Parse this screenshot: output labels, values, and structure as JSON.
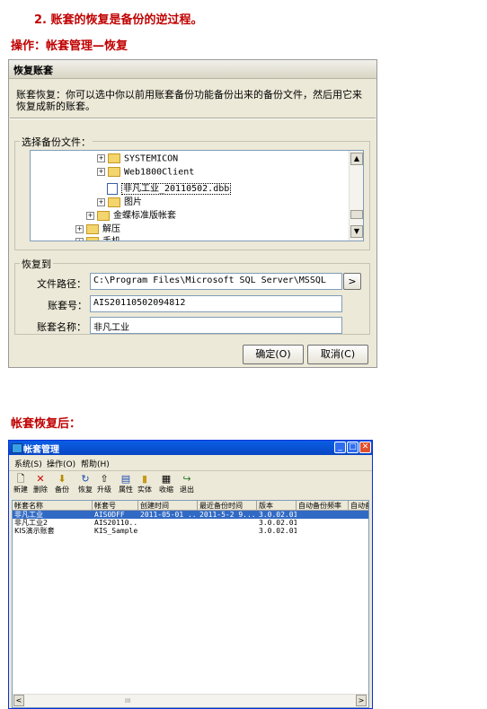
{
  "doc": {
    "step_heading_num": "2.",
    "step_heading_text": "账套的恢复是备份的逆过程。",
    "operation_heading": "操作：帐套管理—恢复",
    "after_heading": "帐套恢复后："
  },
  "restore_dialog": {
    "title": "恢复账套",
    "description": "账套恢复：你可以选中你以前用账套备份功能备份出来的备份文件，然后用它来恢复成新的账套。",
    "file_group_label": "选择备份文件：",
    "tree": [
      {
        "label": "SYSTEMICON",
        "type": "folder",
        "expander": "+"
      },
      {
        "label": "Web1800Client",
        "type": "folder",
        "expander": "+"
      },
      {
        "label": "非凡工业_20110502.dbb",
        "type": "file",
        "expander": "",
        "selected": true
      },
      {
        "label": "图片",
        "type": "folder",
        "expander": "+"
      },
      {
        "label": "金蝶标准版帐套",
        "type": "folder",
        "expander": "+"
      },
      {
        "label": "解压",
        "type": "folder",
        "expander": "+"
      },
      {
        "label": "手机",
        "type": "folder",
        "expander": "+"
      }
    ],
    "restore_to_label": "恢复到",
    "path_label": "文件路径：",
    "path_value": "C:\\Program Files\\Microsoft SQL Server\\MSSQL",
    "browse_label": ">",
    "account_no_label": "账套号：",
    "account_no_value": "AIS20110502094812",
    "account_name_label": "账套名称：",
    "account_name_value": "非凡工业",
    "ok_label": "确定(O)",
    "cancel_label": "取消(C)"
  },
  "account_window": {
    "title": "帐套管理",
    "menu": [
      "系统(S)",
      "操作(O)",
      "帮助(H)"
    ],
    "toolbar": [
      {
        "label": "新建",
        "icon": "new-icon",
        "glyph": "🗋"
      },
      {
        "label": "删除",
        "icon": "delete-icon",
        "glyph": "✕"
      },
      {
        "label": "备份",
        "icon": "backup-icon",
        "glyph": "⬇"
      },
      {
        "label": "恢复",
        "icon": "restore-icon",
        "glyph": "↻"
      },
      {
        "label": "升级",
        "icon": "upgrade-icon",
        "glyph": "⇧"
      },
      {
        "label": "属性",
        "icon": "properties-icon",
        "glyph": "▤"
      },
      {
        "label": "实体",
        "icon": "entity-icon",
        "glyph": "▮"
      },
      {
        "label": "收缩",
        "icon": "shrink-icon",
        "glyph": "▦"
      },
      {
        "label": "退出",
        "icon": "exit-icon",
        "glyph": "↪"
      }
    ],
    "columns": [
      "帐套名称",
      "帐套号",
      "创建时间",
      "最近备份时间",
      "版本",
      "自动备份频率",
      "自动备"
    ],
    "rows": [
      [
        "非凡工业",
        "AIS0DFF",
        "2011-05-01 ...",
        "2011-5-2 9...",
        "3.0.02.01",
        "",
        ""
      ],
      [
        "非凡工业2",
        "AIS20110...",
        "",
        "",
        "3.0.02.01",
        "",
        ""
      ],
      [
        "KIS演示账套",
        "KIS_Sample",
        "",
        "",
        "3.0.02.01",
        "",
        ""
      ]
    ],
    "scroll_left": "<",
    "scroll_right": ">",
    "scroll_mid": "III"
  },
  "colors": {
    "heading_red": "#c00000",
    "selection_blue": "#316ac5",
    "titlebar_blue": "#0a5fe4"
  }
}
